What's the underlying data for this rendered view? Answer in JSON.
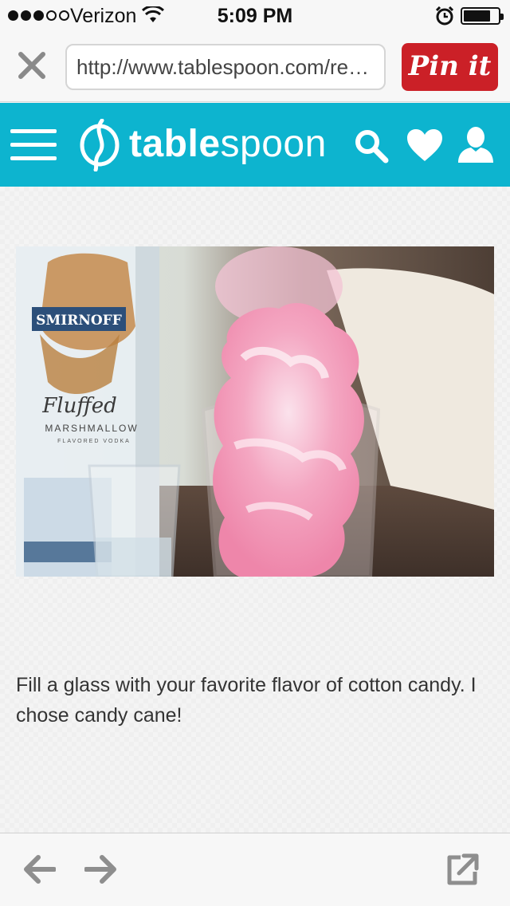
{
  "status": {
    "signal_bars_on": 3,
    "signal_bars_total": 5,
    "carrier": "Verizon",
    "time": "5:09 PM",
    "battery_level": 0.75
  },
  "browser": {
    "url": "http://www.tablespoon.com/re…",
    "pin_label": "Pin it"
  },
  "site": {
    "logo_bold": "table",
    "logo_light": "spoon",
    "accent_color": "#0db4cf"
  },
  "article": {
    "caption": "Fill a glass with your favorite flavor of cotton candy. I chose candy cane!",
    "photo_bottle_brand": "SMIRNOFF",
    "photo_bottle_line1": "Fluffed",
    "photo_bottle_line2": "MARSHMALLOW",
    "photo_bottle_line3": "FLAVORED VODKA"
  },
  "colors": {
    "pin_red": "#cb2027",
    "toolbar_icon": "#8e8e8e"
  }
}
